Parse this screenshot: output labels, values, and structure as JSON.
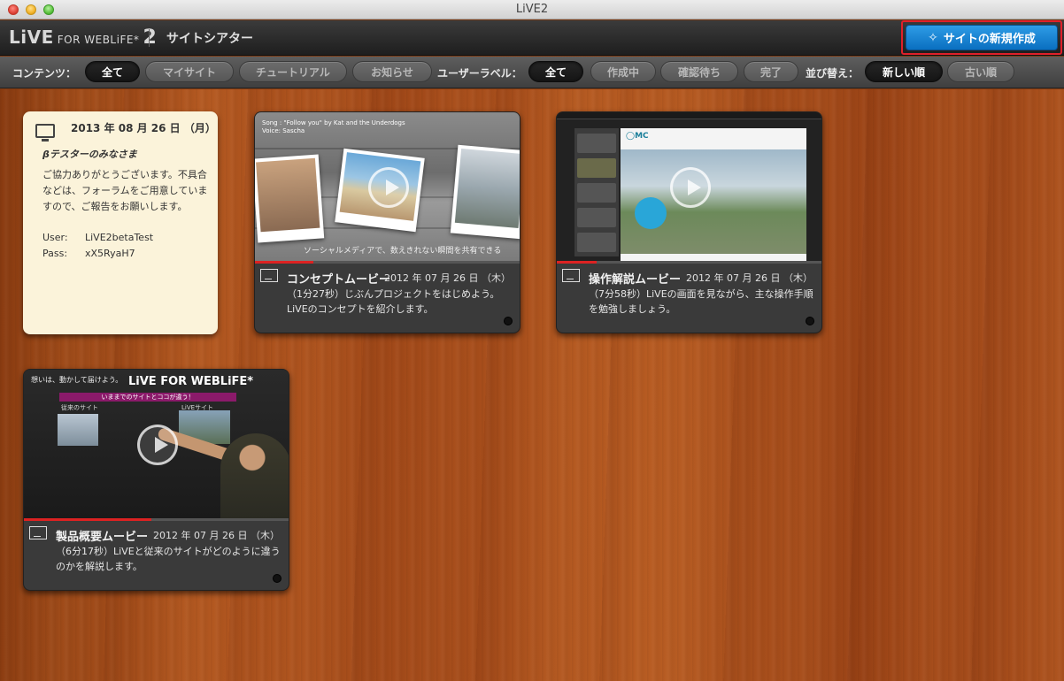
{
  "window": {
    "title": "LiVE2"
  },
  "header": {
    "logo_main": "LiVE",
    "logo_sub": "FOR WEBLiFE*",
    "logo_version": "2",
    "page_title": "サイトシアター",
    "new_site_label": "サイトの新規作成"
  },
  "filters": {
    "contents_label": "コンテンツ：",
    "contents": [
      {
        "label": "全て",
        "active": true
      },
      {
        "label": "マイサイト",
        "active": false
      },
      {
        "label": "チュートリアル",
        "active": false
      },
      {
        "label": "お知らせ",
        "active": false
      }
    ],
    "user_label_label": "ユーザーラベル：",
    "user_labels": [
      {
        "label": "全て",
        "active": true
      },
      {
        "label": "作成中",
        "active": false
      },
      {
        "label": "確認待ち",
        "active": false
      },
      {
        "label": "完了",
        "active": false
      }
    ],
    "sort_label": "並び替え：",
    "sort": [
      {
        "label": "新しい順",
        "active": true
      },
      {
        "label": "古い順",
        "active": false
      }
    ]
  },
  "note": {
    "date": "2013 年 08 月 26 日 （月）",
    "heading": "βテスターのみなさま",
    "body": "ご協力ありがとうございます。不具合などは、フォーラムをご用意していますので、ご報告をお願いします。",
    "user_key": "User:",
    "user_value": "LiVE2betaTest",
    "pass_key": "Pass:",
    "pass_value": "xX5RyaH7"
  },
  "videos": [
    {
      "title": "コンセプトムービー",
      "date": "2012 年 07 月 26 日 （木）",
      "description": "（1分27秒）じぶんプロジェクトをはじめよう。LiVEのコンセプトを紹介します。",
      "progress": 0.22,
      "song_line1": "Song : \"Follow you\" by Kat and the Underdogs",
      "song_line2": "Voice: Sascha",
      "caption": "ソーシャルメディアで、数えきれない瞬間を共有できる"
    },
    {
      "title": "操作解説ムービー",
      "date": "2012 年 07 月 26 日 （木）",
      "description": "（7分58秒）LiVEの画面を見ながら、主な操作手順を勉強しましょう。",
      "progress": 0.15
    },
    {
      "title": "製品概要ムービー",
      "date": "2012 年 07 月 26 日 （木）",
      "description": "（6分17秒）LiVEと従来のサイトがどのように違うのかを解説します。",
      "progress": 0.48,
      "slide_header": "想いは、動かして届けよう。",
      "slide_brand": "LiVE FOR WEBLiFE*",
      "slide_band": "いままでのサイトとココが違う！",
      "slide_left": "従来のサイト",
      "slide_right": "LiVEサイト"
    }
  ],
  "colors": {
    "accent_blue": "#1a86d6",
    "highlight_red": "#e0202a",
    "progress_red": "#dd2222",
    "note_bg": "#fbf3da"
  },
  "icons": {
    "new_site": "sparkle-icon",
    "note": "monitor-icon",
    "video": "screen-icon"
  }
}
